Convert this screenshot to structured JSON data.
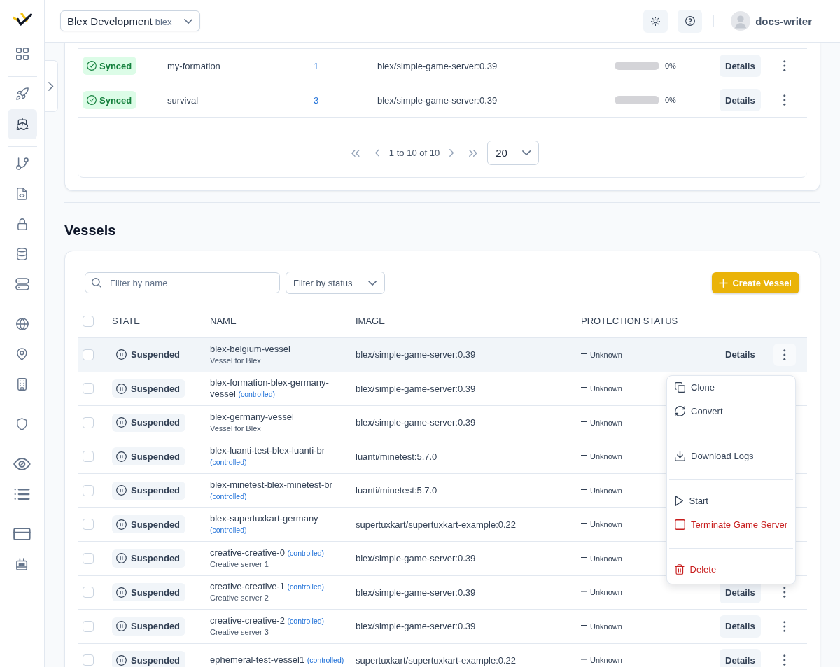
{
  "sidebar": {
    "groups": [
      {
        "items": [
          {
            "selected": false
          }
        ]
      },
      {
        "items": [
          {
            "selected": false
          },
          {
            "selected": true
          }
        ]
      },
      {
        "items": [
          {
            "selected": false
          },
          {
            "selected": false
          },
          {
            "selected": false
          },
          {
            "selected": false
          },
          {
            "selected": false
          }
        ]
      },
      {
        "items": [
          {
            "selected": false
          },
          {
            "selected": false
          },
          {
            "selected": false
          }
        ]
      },
      {
        "items": [
          {
            "selected": false
          }
        ]
      },
      {
        "items": [
          {
            "selected": false
          },
          {
            "selected": false
          }
        ]
      },
      {
        "items": [
          {
            "selected": false
          },
          {
            "selected": false
          }
        ]
      }
    ]
  },
  "header": {
    "organization": {
      "name": "Blex Development",
      "slug": "blex"
    },
    "user": {
      "name": "docs-writer"
    }
  },
  "upper_table": {
    "rows": [
      {
        "column_1": {
          "label": "Synced",
          "kind": "synced"
        },
        "column_2": "my-formation",
        "column_3": "1",
        "column_4": "blex/simple-game-server:0.39",
        "column_5": {
          "level": 0,
          "reading": "0%"
        },
        "action": "Details"
      },
      {
        "column_1": {
          "label": "Synced",
          "kind": "synced"
        },
        "column_2": "survival",
        "column_3": "3",
        "column_4": "blex/simple-game-server:0.39",
        "column_5": {
          "level": 0,
          "reading": "0%"
        },
        "action": "Details"
      }
    ],
    "pagination": {
      "range": "1 to 10 of 10",
      "page_size": "20"
    }
  },
  "vessels": {
    "title": "Vessels",
    "search": {
      "placeholder": "Filter by name"
    },
    "status_filter": {
      "placeholder": "Filter by status"
    },
    "create_button": "Create Vessel",
    "select_all": {
      "checked": false
    },
    "columns": [
      "STATE",
      "NAME",
      "IMAGE",
      "PROTECTION STATUS"
    ],
    "rows": [
      {
        "checked": false,
        "active": true,
        "state": {
          "label": "Suspended",
          "kind": "suspended"
        },
        "name": "blex-belgium-vessel",
        "description": "Vessel for Blex",
        "image": "blex/simple-game-server:0.39",
        "protection": "Unknown",
        "action": "Details"
      },
      {
        "checked": false,
        "active": false,
        "state": {
          "label": "Suspended",
          "kind": "suspended"
        },
        "name": "blex-formation-blex-germany-vessel",
        "tag": "(controlled)",
        "image": "blex/simple-game-server:0.39",
        "protection": "Unknown"
      },
      {
        "checked": false,
        "active": false,
        "state": {
          "label": "Suspended",
          "kind": "suspended"
        },
        "name": "blex-germany-vessel",
        "description": "Vessel for Blex",
        "image": "blex/simple-game-server:0.39",
        "protection": "Unknown"
      },
      {
        "checked": false,
        "active": false,
        "state": {
          "label": "Suspended",
          "kind": "suspended"
        },
        "name": "blex-luanti-test-blex-luanti-br",
        "tag": "(controlled)",
        "image": "luanti/minetest:5.7.0",
        "protection": "Unknown"
      },
      {
        "checked": false,
        "active": false,
        "state": {
          "label": "Suspended",
          "kind": "suspended"
        },
        "name": "blex-minetest-blex-minetest-br",
        "tag": "(controlled)",
        "image": "luanti/minetest:5.7.0",
        "protection": "Unknown"
      },
      {
        "checked": false,
        "active": false,
        "state": {
          "label": "Suspended",
          "kind": "suspended"
        },
        "name": "blex-supertuxkart-germany",
        "tag": "(controlled)",
        "image": "supertuxkart/supertuxkart-example:0.22",
        "protection": "Unknown"
      },
      {
        "checked": false,
        "active": false,
        "state": {
          "label": "Suspended",
          "kind": "suspended"
        },
        "name": "creative-creative-0",
        "tag": "(controlled)",
        "description": "Creative server 1",
        "image": "blex/simple-game-server:0.39",
        "protection": "Unknown"
      },
      {
        "checked": false,
        "active": false,
        "state": {
          "label": "Suspended",
          "kind": "suspended"
        },
        "name": "creative-creative-1",
        "tag": "(controlled)",
        "description": "Creative server 2",
        "image": "blex/simple-game-server:0.39",
        "protection": "Unknown",
        "action": "Details"
      },
      {
        "checked": false,
        "active": false,
        "state": {
          "label": "Suspended",
          "kind": "suspended"
        },
        "name": "creative-creative-2",
        "tag": "(controlled)",
        "description": "Creative server 3",
        "image": "blex/simple-game-server:0.39",
        "protection": "Unknown",
        "action": "Details"
      },
      {
        "checked": false,
        "active": false,
        "state": {
          "label": "Suspended",
          "kind": "suspended"
        },
        "name": "ephemeral-test-vessel1",
        "tag": "(controlled)",
        "image": "supertuxkart/supertuxkart-example:0.22",
        "protection": "Unknown",
        "action": "Details"
      }
    ],
    "row_menu": {
      "groups": [
        {
          "items": [
            {
              "label": "Clone",
              "danger": false
            },
            {
              "label": "Convert",
              "danger": false
            }
          ]
        },
        {
          "items": [
            {
              "label": "Download Logs",
              "danger": false
            }
          ]
        },
        {
          "items": [
            {
              "label": "Start",
              "danger": false
            },
            {
              "label": "Terminate Game Server",
              "danger": true
            }
          ]
        },
        {
          "items": [
            {
              "label": "Delete",
              "danger": true
            }
          ]
        }
      ]
    }
  }
}
